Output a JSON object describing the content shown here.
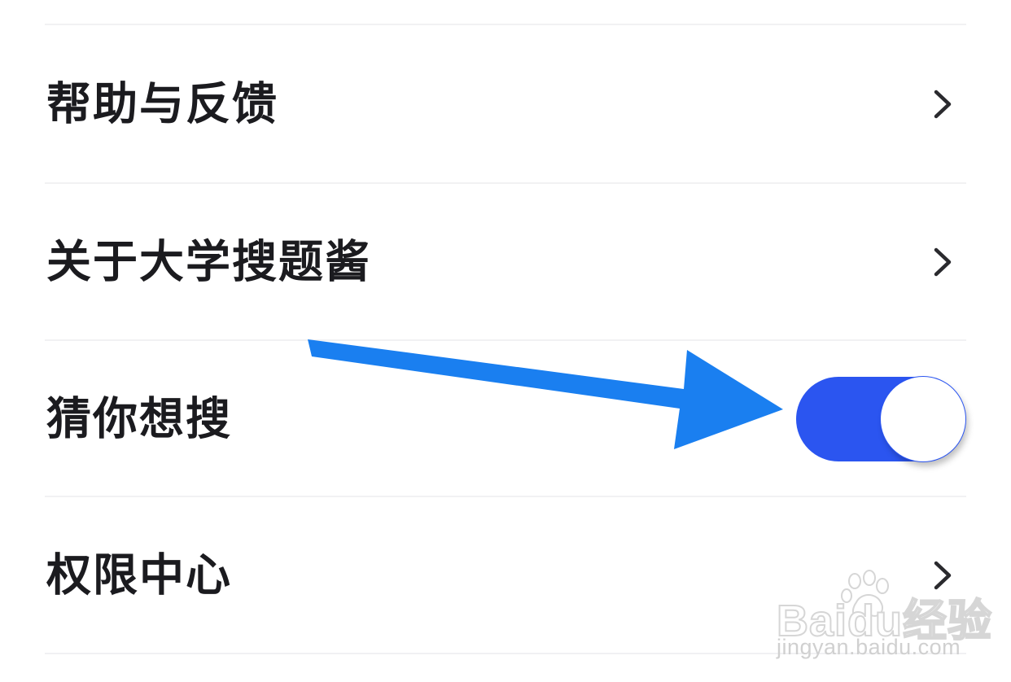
{
  "settings": {
    "items": [
      {
        "label": "帮助与反馈",
        "control": "chevron-right-icon"
      },
      {
        "label": "关于大学搜题酱",
        "control": "chevron-right-icon"
      },
      {
        "label": "猜你想搜",
        "control": "toggle",
        "toggle_on": true
      },
      {
        "label": "权限中心",
        "control": "chevron-right-icon"
      }
    ]
  },
  "toggle_colors": {
    "track_on": "#2b55f0",
    "knob": "#ffffff"
  },
  "annotation": {
    "arrow_icon": "arrow-right-icon",
    "arrow_color": "#1a7ff0"
  },
  "watermark": {
    "logo_text": "Baidu经验",
    "url": "jingyan.baidu.com"
  }
}
